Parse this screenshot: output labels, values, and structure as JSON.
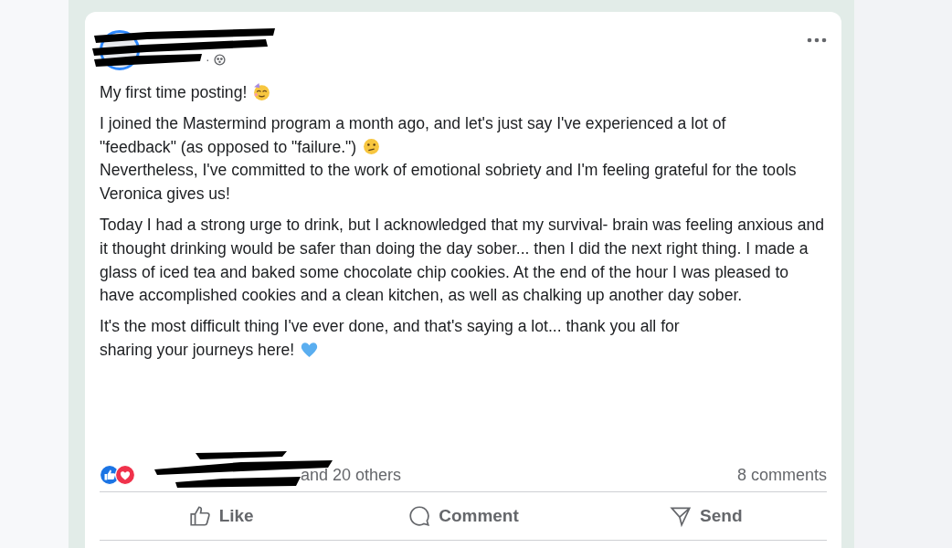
{
  "post": {
    "meta_separator": "·",
    "paragraphs": [
      {
        "lines": [
          {
            "text": "My first time posting!",
            "kind": "party"
          }
        ]
      },
      {
        "lines": [
          {
            "text": "I joined the Mastermind program a month ago, and let's just say I've experienced a lot of"
          },
          {
            "text": "\"feedback\" (as opposed to \"failure.\")",
            "kind": "confused"
          },
          {
            "text": "Nevertheless, I've committed to the work of emotional sobriety and I'm feeling grateful for the tools Veronica gives us!"
          }
        ]
      },
      {
        "lines": [
          {
            "text": "Today I had a strong urge to drink, but I acknowledged that my survival- brain was feeling anxious and it thought drinking would be safer than doing the day sober... then I did the next right thing. I made a glass of iced tea and baked some chocolate chip cookies. At the end of the hour I was pleased to have accomplished cookies and a clean kitchen, as well as chalking up another day sober."
          }
        ]
      },
      {
        "lines": [
          {
            "text": "It's the most difficult thing I've ever done, and that's saying a lot... thank you all for"
          },
          {
            "text": "sharing your journeys here!",
            "kind": "heart"
          }
        ]
      }
    ],
    "reactions": {
      "others": "and 20 others",
      "comments": "8 comments"
    },
    "actions": [
      {
        "kind": "like",
        "label": "Like"
      },
      {
        "kind": "comment",
        "label": "Comment"
      },
      {
        "kind": "send",
        "label": "Send"
      }
    ]
  }
}
